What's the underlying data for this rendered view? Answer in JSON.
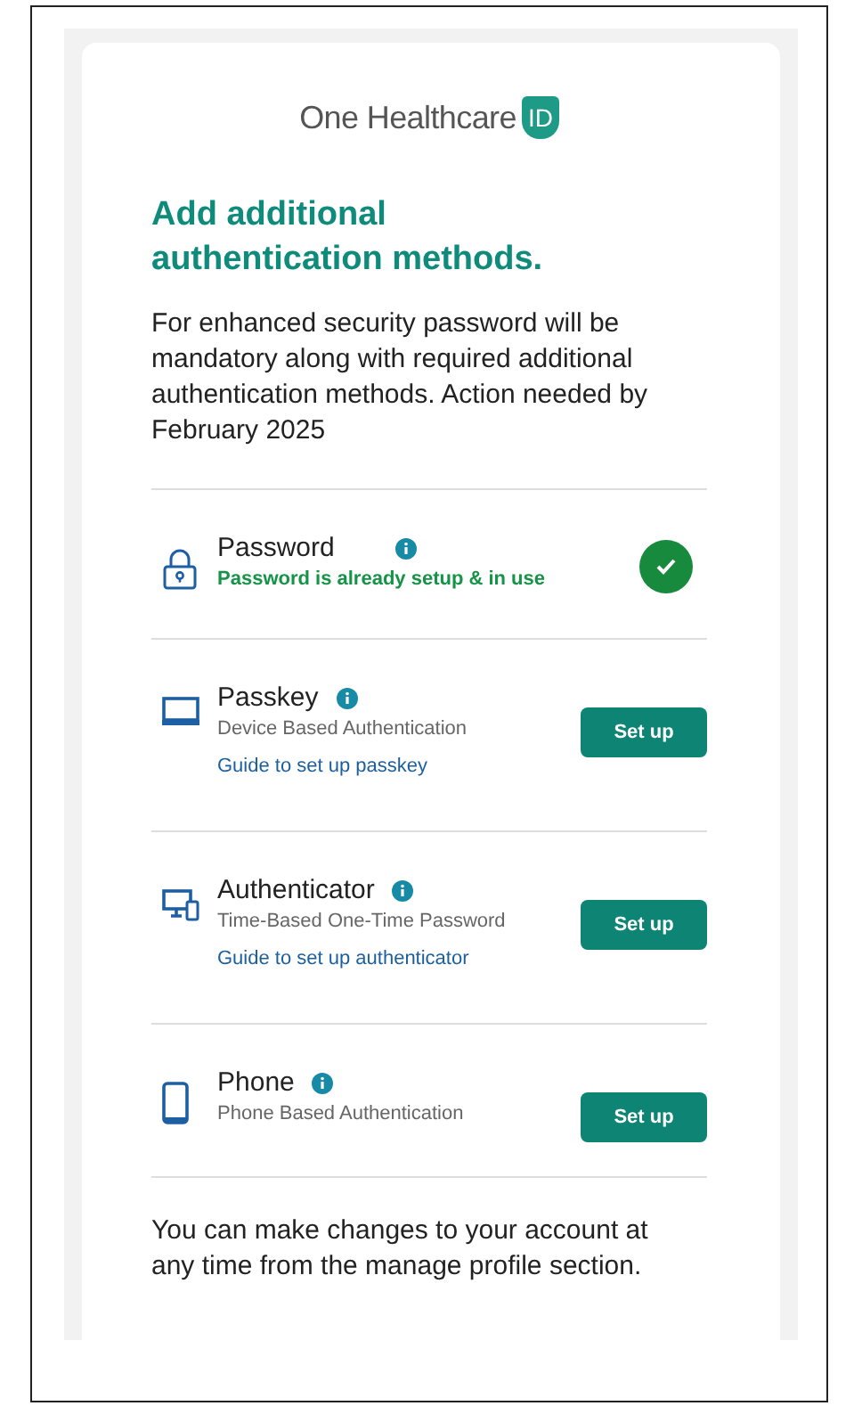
{
  "brand": {
    "name": "One Healthcare",
    "badge": "ID"
  },
  "title": "Add additional authentication methods.",
  "intro": "For enhanced security password will be mandatory along with required additional authentication methods. Action needed by February 2025",
  "methods": [
    {
      "name": "Password",
      "kind": "lock",
      "status": "Password is already setup & in use",
      "done": true
    },
    {
      "name": "Passkey",
      "kind": "monitor",
      "description": "Device Based Authentication",
      "guide": "Guide to set up passkey",
      "button": "Set up",
      "done": false
    },
    {
      "name": "Authenticator",
      "kind": "devices",
      "description": "Time-Based One-Time Password",
      "guide": "Guide to set up authenticator",
      "button": "Set up",
      "done": false
    },
    {
      "name": "Phone",
      "kind": "phone",
      "description": "Phone Based Authentication",
      "button": "Set up",
      "done": false
    }
  ],
  "footer": "You can make changes to your account at any time from the manage profile section."
}
